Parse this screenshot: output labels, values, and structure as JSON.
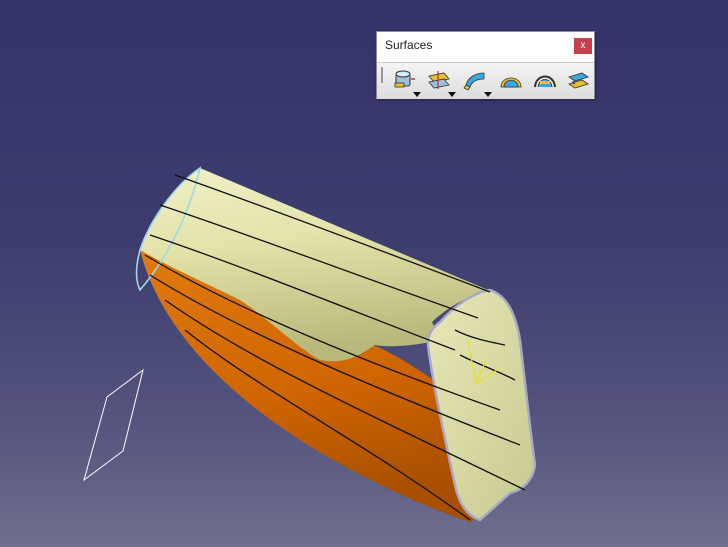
{
  "toolbar": {
    "title": "Surfaces",
    "close_label": "x",
    "tools": [
      {
        "name": "extrude-surface-icon",
        "has_dropdown": true
      },
      {
        "name": "offset-surface-icon",
        "has_dropdown": true
      },
      {
        "name": "sweep-surface-icon",
        "has_dropdown": true
      },
      {
        "name": "fill-surface-icon",
        "has_dropdown": false
      },
      {
        "name": "multi-section-surface-icon",
        "has_dropdown": false
      },
      {
        "name": "blend-surface-icon",
        "has_dropdown": false
      }
    ]
  },
  "viewport": {
    "background_top": "#33336a",
    "background_bottom": "#6f6f8e",
    "surface_outer_color": "#d8d89a",
    "surface_inner_color": "#d26a00"
  }
}
